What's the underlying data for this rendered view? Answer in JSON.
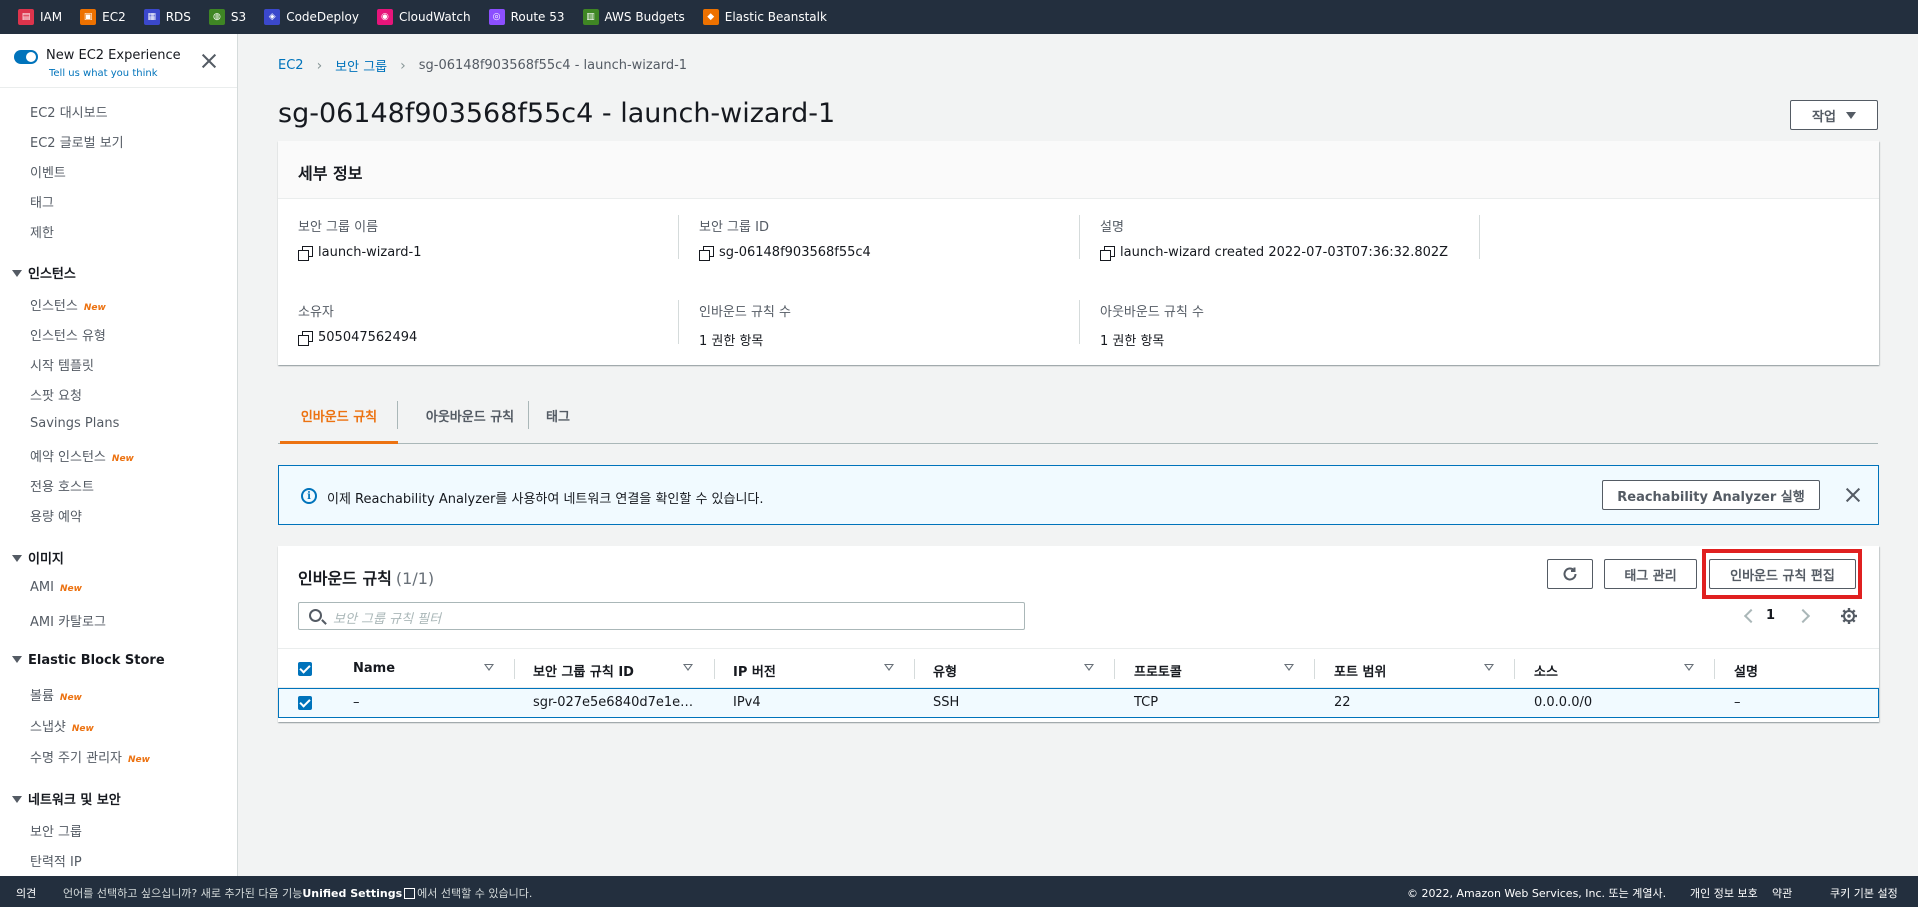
{
  "favorites": [
    {
      "label": "IAM",
      "color": "#dd344c",
      "icon": "iam-icon"
    },
    {
      "label": "EC2",
      "color": "#ed7100",
      "icon": "ec2-icon"
    },
    {
      "label": "RDS",
      "color": "#3b48cc",
      "icon": "rds-icon"
    },
    {
      "label": "S3",
      "color": "#3f8624",
      "icon": "s3-icon"
    },
    {
      "label": "CodeDeploy",
      "color": "#3b48cc",
      "icon": "codedeploy-icon"
    },
    {
      "label": "CloudWatch",
      "color": "#e7157b",
      "icon": "cloudwatch-icon"
    },
    {
      "label": "Route 53",
      "color": "#8c4fff",
      "icon": "route53-icon"
    },
    {
      "label": "AWS Budgets",
      "color": "#3f8624",
      "icon": "budgets-icon"
    },
    {
      "label": "Elastic Beanstalk",
      "color": "#ed7100",
      "icon": "beanstalk-icon"
    }
  ],
  "sidebar": {
    "experience_title": "New EC2 Experience",
    "experience_link": "Tell us what you think",
    "new_badge": "New",
    "top_items": [
      "EC2 대시보드",
      "EC2 글로벌 보기",
      "이벤트",
      "태그",
      "제한"
    ],
    "sections": {
      "instances": {
        "title": "인스턴스",
        "items": [
          "인스턴스",
          "인스턴스 유형",
          "시작 템플릿",
          "스팟 요청",
          "Savings Plans",
          "예약 인스턴스",
          "전용 호스트",
          "용량 예약"
        ]
      },
      "images": {
        "title": "이미지",
        "items": [
          "AMI",
          "AMI 카탈로그"
        ]
      },
      "ebs": {
        "title": "Elastic Block Store",
        "items": [
          "볼륨",
          "스냅샷",
          "수명 주기 관리자"
        ]
      },
      "network": {
        "title": "네트워크 및 보안",
        "items": [
          "보안 그룹",
          "탄력적 IP"
        ]
      }
    }
  },
  "breadcrumb": {
    "root": "EC2",
    "parent": "보안 그룹",
    "current": "sg-06148f903568f55c4 - launch-wizard-1"
  },
  "page_title": "sg-06148f903568f55c4 - launch-wizard-1",
  "actions_button": "작업",
  "details": {
    "header": "세부 정보",
    "fields": {
      "name": {
        "label": "보안 그룹 이름",
        "value": "launch-wizard-1"
      },
      "id": {
        "label": "보안 그룹 ID",
        "value": "sg-06148f903568f55c4"
      },
      "desc": {
        "label": "설명",
        "value": "launch-wizard created 2022-07-03T07:36:32.802Z"
      },
      "owner": {
        "label": "소유자",
        "value": "505047562494"
      },
      "inbound": {
        "label": "인바운드 규칙 수",
        "value": "1 권한 항목"
      },
      "outbound": {
        "label": "아웃바운드 규칙 수",
        "value": "1 권한 항목"
      }
    }
  },
  "tabs": [
    "인바운드 규칙",
    "아웃바운드 규칙",
    "태그"
  ],
  "alert": {
    "text": "이제 Reachability Analyzer를 사용하여 네트워크 연결을 확인할 수 있습니다.",
    "button": "Reachability Analyzer 실행"
  },
  "rules": {
    "title": "인바운드 규칙",
    "count": "(1/1)",
    "manage_tags": "태그 관리",
    "edit": "인바운드 규칙 편집",
    "search_placeholder": "보안 그룹 규칙 필터",
    "page": "1",
    "columns": [
      "Name",
      "보안 그룹 규칙 ID",
      "IP 버전",
      "유형",
      "프로토콜",
      "포트 범위",
      "소스",
      "설명"
    ],
    "rows": [
      [
        "–",
        "sgr-027e5e6840d7e1e…",
        "IPv4",
        "SSH",
        "TCP",
        "22",
        "0.0.0.0/0",
        "–"
      ]
    ]
  },
  "footer": {
    "feedback": "의견",
    "lang_a": "언어를 선택하고 싶으십니까? 새로 추가된 다음 기능",
    "lang_b": "Unified Settings",
    "lang_c": "에서 선택할 수 있습니다.",
    "copyright": "© 2022, Amazon Web Services, Inc. 또는 계열사.",
    "privacy": "개인 정보 보호",
    "terms": "약관",
    "cookies": "쿠키 기본 설정"
  },
  "colors": {
    "accent": "#0073bb",
    "active_tab": "#ec7211",
    "highlight_box": "#e02020"
  }
}
